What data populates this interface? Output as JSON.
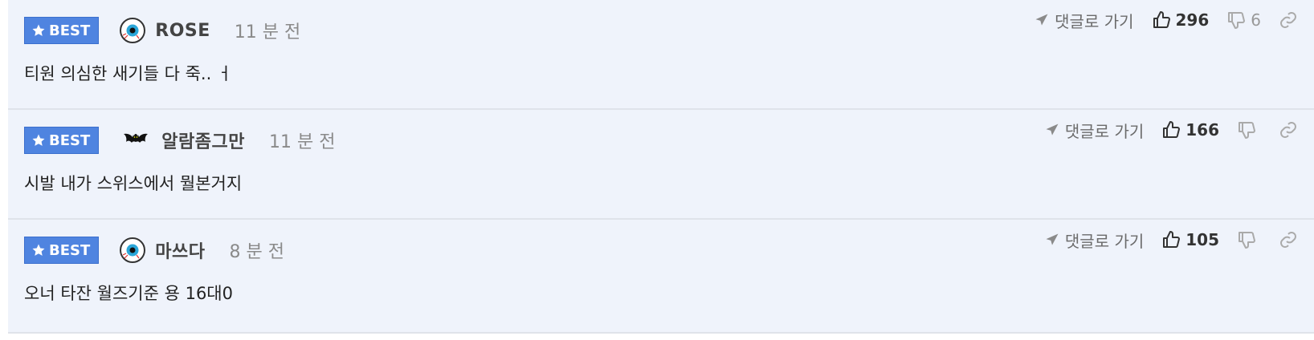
{
  "comments": [
    {
      "badge": "BEST",
      "nickname": "ROSE",
      "time": "11 분 전",
      "text": "티원 의심한 새기들 다 죽.. ㅓ",
      "goto_label": "댓글로 가기",
      "upvotes": "296",
      "downvotes": "6",
      "level_icon": "eyeball-icon"
    },
    {
      "badge": "BEST",
      "nickname": "알람좀그만",
      "time": "11 분 전",
      "text": "시발 내가 스위스에서 뭘본거지",
      "goto_label": "댓글로 가기",
      "upvotes": "166",
      "downvotes": "",
      "level_icon": "bat-icon"
    },
    {
      "badge": "BEST",
      "nickname": "마쓰다",
      "time": "8 분 전",
      "text": "오너 타잔 월즈기준 용 16대0",
      "goto_label": "댓글로 가기",
      "upvotes": "105",
      "downvotes": "",
      "level_icon": "eyeball-icon"
    }
  ],
  "colors": {
    "background": "#eff3fb",
    "badge": "#4f84e0",
    "divider": "#dfe3ea"
  }
}
